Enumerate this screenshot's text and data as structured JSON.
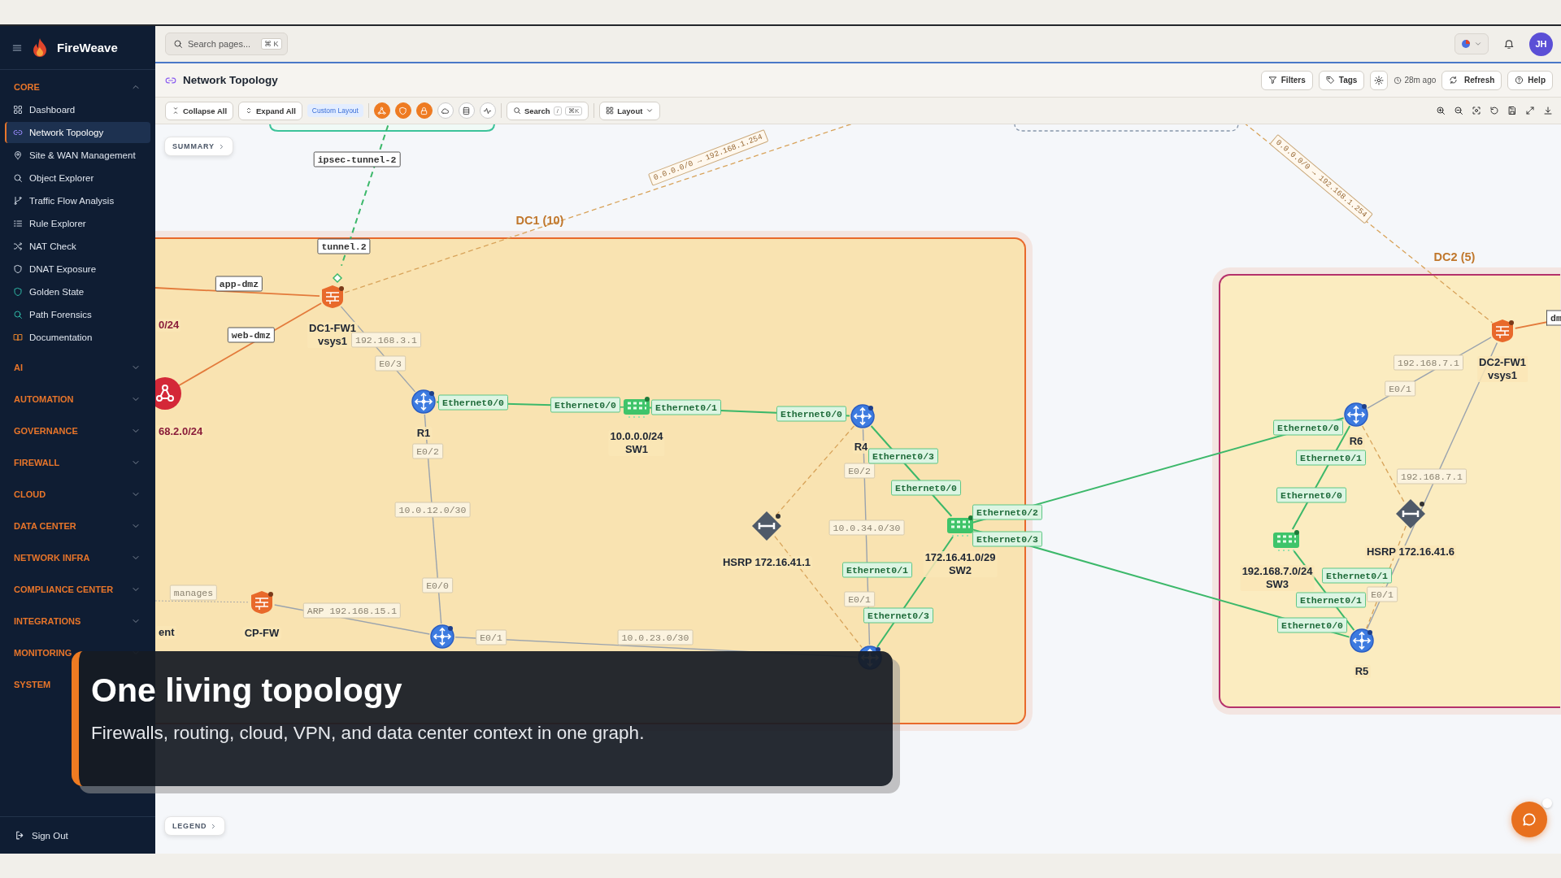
{
  "app": {
    "name": "FireWeave"
  },
  "sidebar": {
    "sections": [
      {
        "label": "CORE",
        "expanded": true,
        "items": [
          {
            "label": "Dashboard",
            "selected": false
          },
          {
            "label": "Network Topology",
            "selected": true
          },
          {
            "label": "Site & WAN Management",
            "selected": false
          },
          {
            "label": "Object Explorer",
            "selected": false
          },
          {
            "label": "Traffic Flow Analysis",
            "selected": false
          },
          {
            "label": "Rule Explorer",
            "selected": false
          },
          {
            "label": "NAT Check",
            "selected": false
          },
          {
            "label": "DNAT Exposure",
            "selected": false
          },
          {
            "label": "Golden State",
            "selected": false
          },
          {
            "label": "Path Forensics",
            "selected": false
          },
          {
            "label": "Documentation",
            "selected": false
          }
        ]
      },
      {
        "label": "AI",
        "expanded": false
      },
      {
        "label": "AUTOMATION",
        "expanded": false
      },
      {
        "label": "GOVERNANCE",
        "expanded": false
      },
      {
        "label": "FIREWALL",
        "expanded": false
      },
      {
        "label": "CLOUD",
        "expanded": false
      },
      {
        "label": "DATA CENTER",
        "expanded": false
      },
      {
        "label": "NETWORK INFRA",
        "expanded": false
      },
      {
        "label": "COMPLIANCE CENTER",
        "expanded": false
      },
      {
        "label": "INTEGRATIONS",
        "expanded": false
      },
      {
        "label": "MONITORING",
        "expanded": false
      },
      {
        "label": "SYSTEM",
        "expanded": false
      }
    ],
    "sign_out": "Sign Out"
  },
  "header": {
    "search": {
      "placeholder": "Search pages...",
      "shortcut": "⌘ K"
    },
    "avatar": "JH"
  },
  "page": {
    "title": "Network Topology",
    "filters": "Filters",
    "tags": "Tags",
    "updated": "28m ago",
    "refresh": "Refresh",
    "help": "Help"
  },
  "toolbar": {
    "collapse": "Collapse All",
    "expand": "Expand All",
    "layout_badge": "Custom Layout",
    "toggles": [
      {
        "on": true
      },
      {
        "on": true
      },
      {
        "on": true
      },
      {
        "on": false
      },
      {
        "on": false
      },
      {
        "on": false
      }
    ],
    "search": {
      "label": "Search",
      "keys": [
        "/",
        "⌘K"
      ]
    },
    "layout": "Layout"
  },
  "canvas": {
    "summary": "SUMMARY",
    "legend": "LEGEND",
    "groups": [
      {
        "label": "DC1 (10)",
        "color": "#e8692b"
      },
      {
        "label": "DC2 (5)",
        "color": "#b5316b"
      }
    ],
    "nodes": [
      {
        "kind": "firewall",
        "label": [
          "DC1-FW1",
          "vsys1"
        ]
      },
      {
        "kind": "subnet",
        "label": [
          "68.2.0/24"
        ]
      },
      {
        "kind": "router",
        "label": [
          "R1"
        ]
      },
      {
        "kind": "switch",
        "label": [
          "10.0.0.0/24",
          "SW1"
        ]
      },
      {
        "kind": "router",
        "label": [
          "R4"
        ]
      },
      {
        "kind": "hsrp",
        "label": [
          "HSRP 172.16.41.1"
        ]
      },
      {
        "kind": "switch",
        "label": [
          "172.16.41.0/29",
          "SW2"
        ]
      },
      {
        "kind": "firewall",
        "label": [
          "CP-FW"
        ]
      },
      {
        "kind": "router"
      },
      {
        "kind": "router"
      },
      {
        "kind": "firewall",
        "label": [
          "DC2-FW1",
          "vsys1"
        ]
      },
      {
        "kind": "router",
        "label": [
          "R6"
        ]
      },
      {
        "kind": "hsrp",
        "label": [
          "HSRP 172.16.41.6"
        ]
      },
      {
        "kind": "switch",
        "label": [
          "192.168.7.0/24",
          "SW3"
        ]
      },
      {
        "kind": "router",
        "label": [
          "R5"
        ]
      },
      {
        "kind": "subnet_label",
        "label": [
          "0/24"
        ]
      },
      {
        "kind": "label",
        "label": [
          "ent"
        ]
      }
    ],
    "link_labels": [
      {
        "kind": "tag",
        "text": "ipsec-tunnel-2"
      },
      {
        "kind": "tag",
        "text": "tunnel.2"
      },
      {
        "kind": "tag",
        "text": "app-dmz"
      },
      {
        "kind": "tag",
        "text": "web-dmz"
      },
      {
        "kind": "tag",
        "text": "dm"
      },
      {
        "kind": "route",
        "text": "0.0.0.0/0 → 192.168.1.254"
      },
      {
        "kind": "route",
        "text": "0.0.0.0/0 → 192.168.1.254"
      },
      {
        "kind": "addr",
        "text": "192.168.3.1"
      },
      {
        "kind": "addr",
        "text": "E0/3"
      },
      {
        "kind": "addr",
        "text": "E0/2"
      },
      {
        "kind": "addr",
        "text": "10.0.12.0/30"
      },
      {
        "kind": "addr",
        "text": "E0/0"
      },
      {
        "kind": "addr",
        "text": "manages"
      },
      {
        "kind": "addr",
        "text": "ARP 192.168.15.1"
      },
      {
        "kind": "addr",
        "text": "E0/1"
      },
      {
        "kind": "addr",
        "text": "10.0.23.0/30"
      },
      {
        "kind": "addr",
        "text": "E0/2"
      },
      {
        "kind": "addr",
        "text": "10.0.34.0/30"
      },
      {
        "kind": "addr",
        "text": "E0/1"
      },
      {
        "kind": "addr",
        "text": "192.168.7.1"
      },
      {
        "kind": "addr",
        "text": "E0/1"
      },
      {
        "kind": "addr",
        "text": "192.168.7.1"
      },
      {
        "kind": "addr",
        "text": "E0/1"
      },
      {
        "kind": "iface",
        "text": "Ethernet0/0"
      },
      {
        "kind": "iface",
        "text": "Ethernet0/0"
      },
      {
        "kind": "iface",
        "text": "Ethernet0/1"
      },
      {
        "kind": "iface",
        "text": "Ethernet0/0"
      },
      {
        "kind": "iface",
        "text": "Ethernet0/3"
      },
      {
        "kind": "iface",
        "text": "Ethernet0/0"
      },
      {
        "kind": "iface",
        "text": "Ethernet0/2"
      },
      {
        "kind": "iface",
        "text": "Ethernet0/3"
      },
      {
        "kind": "iface",
        "text": "Ethernet0/1"
      },
      {
        "kind": "iface",
        "text": "Ethernet0/3"
      },
      {
        "kind": "iface",
        "text": "Ethernet0/0"
      },
      {
        "kind": "iface",
        "text": "Ethernet0/1"
      },
      {
        "kind": "iface",
        "text": "Ethernet0/0"
      },
      {
        "kind": "iface",
        "text": "Ethernet0/1"
      },
      {
        "kind": "iface",
        "text": "Ethernet0/1"
      },
      {
        "kind": "iface",
        "text": "Ethernet0/0"
      }
    ]
  },
  "intro": {
    "title": "One living topology",
    "text": "Firewalls, routing, cloud, VPN, and data center context in one graph."
  }
}
